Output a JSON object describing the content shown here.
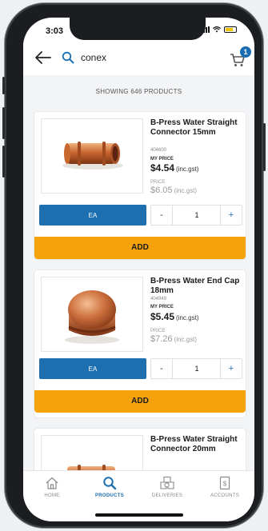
{
  "status": {
    "time": "3:03"
  },
  "search": {
    "value": "conex"
  },
  "cart": {
    "count": "1"
  },
  "results": {
    "showing": "SHOWING 646 PRODUCTS"
  },
  "products": [
    {
      "name": "B-Press Water Straight Connector 15mm",
      "sku": "404600",
      "my_price_label": "MY PRICE",
      "my_price": "$4.54",
      "gst_label": "(inc.gst)",
      "price_label": "PRICE",
      "price": "$6.05",
      "uom": "EA",
      "qty": "1",
      "minus": "-",
      "plus": "+",
      "add_label": "ADD"
    },
    {
      "name": "B-Press Water End Cap 18mm",
      "sku": "404949",
      "my_price_label": "MY PRICE",
      "my_price": "$5.45",
      "gst_label": "(inc.gst)",
      "price_label": "PRICE",
      "price": "$7.26",
      "uom": "EA",
      "qty": "1",
      "minus": "-",
      "plus": "+",
      "add_label": "ADD"
    },
    {
      "name": "B-Press Water Straight Connector 20mm"
    }
  ],
  "tabs": [
    {
      "label": "HOME",
      "icon": "home-icon"
    },
    {
      "label": "PRODUCTS",
      "icon": "search-icon",
      "active": true
    },
    {
      "label": "DELIVERIES",
      "icon": "boxes-icon"
    },
    {
      "label": "ACCOUNTS",
      "icon": "account-doc-icon"
    }
  ],
  "colors": {
    "primary": "#1d6fb0",
    "accent": "#f5a20b"
  }
}
